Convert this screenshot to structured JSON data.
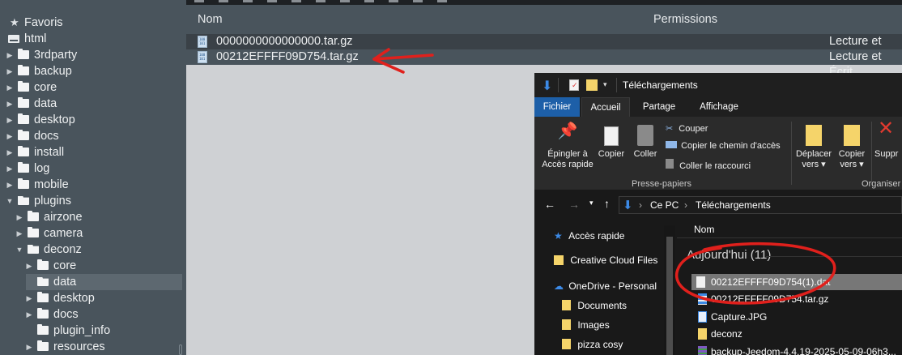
{
  "tree": {
    "favorites": "Favoris",
    "root": "html",
    "items": [
      {
        "label": "3rdparty"
      },
      {
        "label": "backup"
      },
      {
        "label": "core"
      },
      {
        "label": "data"
      },
      {
        "label": "desktop"
      },
      {
        "label": "docs"
      },
      {
        "label": "install"
      },
      {
        "label": "log"
      },
      {
        "label": "mobile"
      },
      {
        "label": "plugins"
      },
      {
        "label": "airzone"
      },
      {
        "label": "camera"
      },
      {
        "label": "deconz"
      },
      {
        "label": "core"
      },
      {
        "label": "data"
      },
      {
        "label": "desktop"
      },
      {
        "label": "docs"
      },
      {
        "label": "plugin_info"
      },
      {
        "label": "resources"
      }
    ]
  },
  "files": {
    "col_name": "Nom",
    "col_permissions": "Permissions",
    "rows": [
      {
        "name": "0000000000000000.tar.gz",
        "perm": "Lecture et Écrit"
      },
      {
        "name": "00212EFFFF09D754.tar.gz",
        "perm": "Lecture et Écrit"
      }
    ]
  },
  "explorer": {
    "title": "Téléchargements",
    "tabs": {
      "file": "Fichier",
      "home": "Accueil",
      "share": "Partage",
      "view": "Affichage"
    },
    "ribbon": {
      "pin_line1": "Épingler à",
      "pin_line2": "Accès rapide",
      "copy": "Copier",
      "paste": "Coller",
      "cut": "Couper",
      "copy_path": "Copier le chemin d'accès",
      "paste_shortcut": "Coller le raccourci",
      "group_clipboard": "Presse-papiers",
      "move_line1": "Déplacer",
      "move_line2": "vers",
      "copyto_line1": "Copier",
      "copyto_line2": "vers",
      "delete": "Suppr",
      "group_organize": "Organiser"
    },
    "address": {
      "pc": "Ce PC",
      "folder": "Téléchargements"
    },
    "nav": {
      "quick_access": "Accès rapide",
      "creative_cloud": "Creative Cloud Files",
      "onedrive": "OneDrive - Personal",
      "documents": "Documents",
      "images": "Images",
      "pizza": "pizza cosy"
    },
    "content": {
      "col_name": "Nom",
      "group": "Aujourd'hui (11)",
      "items": [
        {
          "name": "00212EFFFF09D754(1).dat"
        },
        {
          "name": "00212EFFFF09D754.tar.gz"
        },
        {
          "name": "Capture.JPG"
        },
        {
          "name": "deconz"
        },
        {
          "name": "backup-Jeedom-4.4.19-2025-05-09-06h3..."
        }
      ]
    }
  },
  "colors": {
    "tree_bg": "#49545c",
    "list_bg": "#cfd1d4",
    "annotation_red": "#e0201c",
    "ribbon_file_tab": "#1d5fa8"
  }
}
